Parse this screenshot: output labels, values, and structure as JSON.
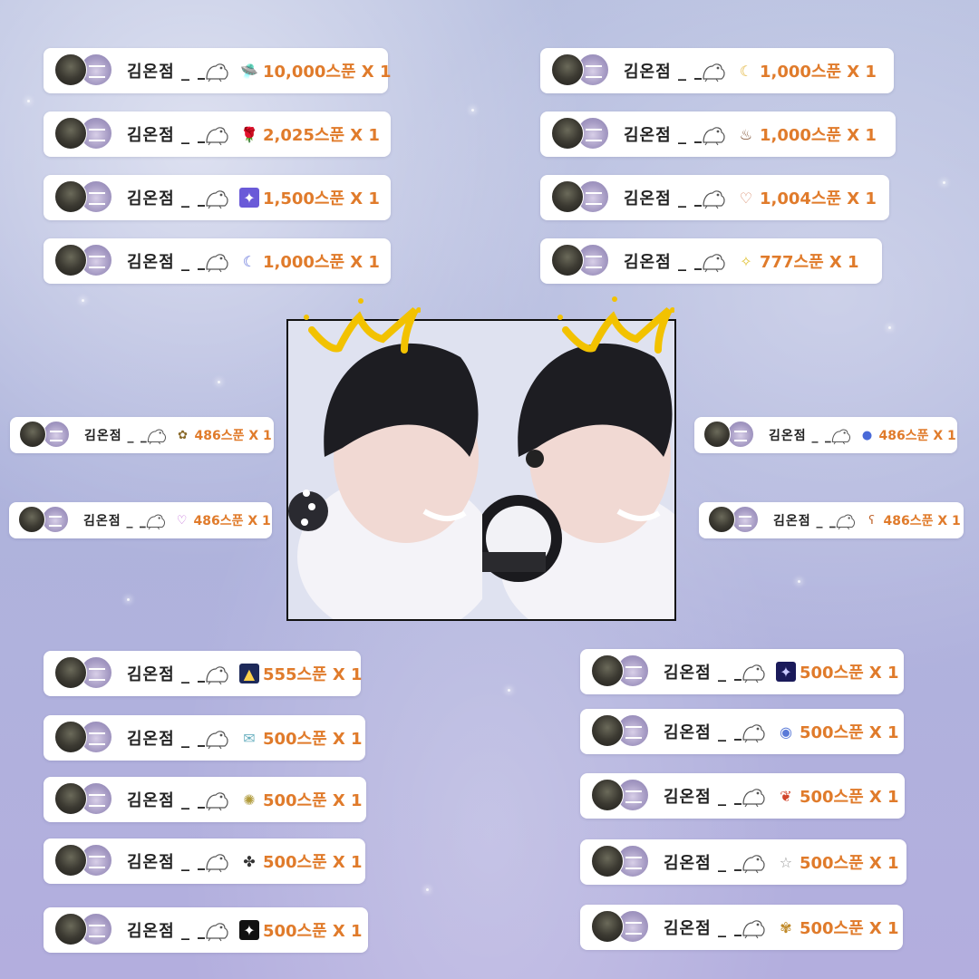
{
  "user": {
    "name": "김온점",
    "suffix": "_"
  },
  "colors": {
    "amount": "#e07b2b",
    "name": "#222222",
    "card": "#ffffff",
    "crown": "#f2c200"
  },
  "donations": [
    {
      "id": "L1",
      "gift": "ufo-icon",
      "amount": "10,000스푼 X 1"
    },
    {
      "id": "L2",
      "gift": "roses-icon",
      "amount": "2,025스푼 X 1"
    },
    {
      "id": "L3",
      "gift": "galaxy-icon",
      "amount": "1,500스푼 X 1"
    },
    {
      "id": "L4",
      "gift": "crescent-moon-icon",
      "amount": "1,000스푼 X 1"
    },
    {
      "id": "R1",
      "gift": "moon-icon",
      "amount": "1,000스푼 X 1"
    },
    {
      "id": "R2",
      "gift": "cake-icon",
      "amount": "1,000스푼 X 1"
    },
    {
      "id": "R3",
      "gift": "wings-icon",
      "amount": "1,004스푼 X 1"
    },
    {
      "id": "R4",
      "gift": "lucky-icon",
      "amount": "777스푼 X 1"
    },
    {
      "id": "LM1",
      "gift": "dragon-icon",
      "amount": "486스푼 X 1"
    },
    {
      "id": "LM2",
      "gift": "heart-icon",
      "amount": "486스푼 X 1"
    },
    {
      "id": "RM1",
      "gift": "potion-icon",
      "amount": "486스푼 X 1"
    },
    {
      "id": "RM2",
      "gift": "bear-icon",
      "amount": "486스푼 X 1"
    },
    {
      "id": "LB1",
      "gift": "temple-icon",
      "amount": "555스푼 X 1"
    },
    {
      "id": "LB2",
      "gift": "envelope-icon",
      "amount": "500스푼 X 1"
    },
    {
      "id": "LB3",
      "gift": "sparkle-icon",
      "amount": "500스푼 X 1"
    },
    {
      "id": "LB4",
      "gift": "cats-icon",
      "amount": "500스푼 X 1"
    },
    {
      "id": "LB5",
      "gift": "star-dark-icon",
      "amount": "500스푼 X 1"
    },
    {
      "id": "RB1",
      "gift": "night-sky-icon",
      "amount": "500스푼 X 1"
    },
    {
      "id": "RB2",
      "gift": "crystal-icon",
      "amount": "500스푼 X 1"
    },
    {
      "id": "RB3",
      "gift": "ribbon-icon",
      "amount": "500스푼 X 1"
    },
    {
      "id": "RB4",
      "gift": "star-outline-icon",
      "amount": "500스푼 X 1"
    },
    {
      "id": "RB5",
      "gift": "butterflies-icon",
      "amount": "500스푼 X 1"
    }
  ]
}
